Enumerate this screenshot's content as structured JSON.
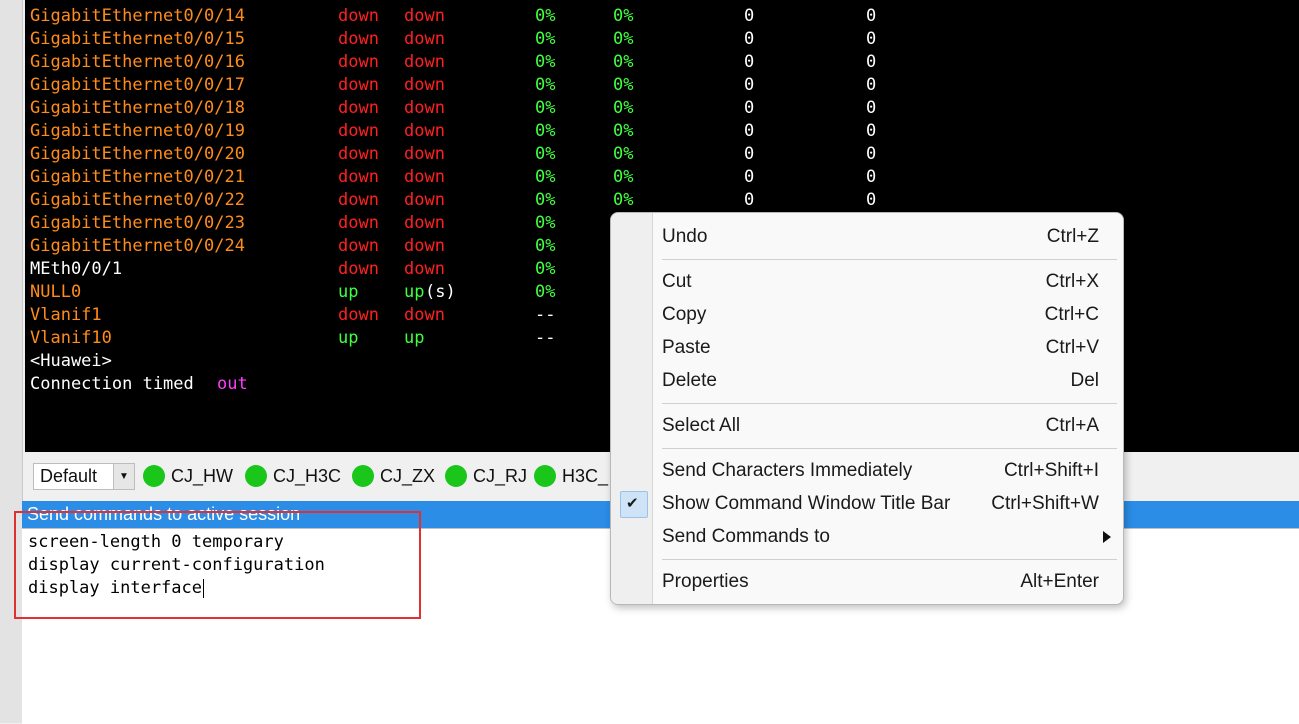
{
  "terminal": {
    "rows": [
      {
        "name": "GigabitEthernet0/0/14",
        "phy": "down",
        "proto": "down",
        "in_uti": "0%",
        "out_uti": "0%",
        "in_err": "0",
        "out_err": "0"
      },
      {
        "name": "GigabitEthernet0/0/15",
        "phy": "down",
        "proto": "down",
        "in_uti": "0%",
        "out_uti": "0%",
        "in_err": "0",
        "out_err": "0"
      },
      {
        "name": "GigabitEthernet0/0/16",
        "phy": "down",
        "proto": "down",
        "in_uti": "0%",
        "out_uti": "0%",
        "in_err": "0",
        "out_err": "0"
      },
      {
        "name": "GigabitEthernet0/0/17",
        "phy": "down",
        "proto": "down",
        "in_uti": "0%",
        "out_uti": "0%",
        "in_err": "0",
        "out_err": "0"
      },
      {
        "name": "GigabitEthernet0/0/18",
        "phy": "down",
        "proto": "down",
        "in_uti": "0%",
        "out_uti": "0%",
        "in_err": "0",
        "out_err": "0"
      },
      {
        "name": "GigabitEthernet0/0/19",
        "phy": "down",
        "proto": "down",
        "in_uti": "0%",
        "out_uti": "0%",
        "in_err": "0",
        "out_err": "0"
      },
      {
        "name": "GigabitEthernet0/0/20",
        "phy": "down",
        "proto": "down",
        "in_uti": "0%",
        "out_uti": "0%",
        "in_err": "0",
        "out_err": "0"
      },
      {
        "name": "GigabitEthernet0/0/21",
        "phy": "down",
        "proto": "down",
        "in_uti": "0%",
        "out_uti": "0%",
        "in_err": "0",
        "out_err": "0"
      },
      {
        "name": "GigabitEthernet0/0/22",
        "phy": "down",
        "proto": "down",
        "in_uti": "0%",
        "out_uti": "0%",
        "in_err": "0",
        "out_err": "0"
      },
      {
        "name": "GigabitEthernet0/0/23",
        "phy": "down",
        "proto": "down",
        "in_uti": "0%",
        "out_uti": "",
        "in_err": "",
        "out_err": ""
      },
      {
        "name": "GigabitEthernet0/0/24",
        "phy": "down",
        "proto": "down",
        "in_uti": "0%",
        "out_uti": "",
        "in_err": "",
        "out_err": ""
      },
      {
        "name": "MEth0/0/1",
        "phy": "down",
        "proto": "down",
        "in_uti": "0%",
        "out_uti": "",
        "in_err": "",
        "out_err": ""
      },
      {
        "name": "NULL0",
        "phy": "up",
        "proto": "up",
        "proto_suffix": "(s)",
        "in_uti": "0%",
        "out_uti": "",
        "in_err": "",
        "out_err": ""
      },
      {
        "name": "Vlanif1",
        "phy": "down",
        "proto": "down",
        "in_uti": "--",
        "out_uti": "",
        "in_err": "",
        "out_err": ""
      },
      {
        "name": "Vlanif10",
        "phy": "up",
        "proto": "up",
        "in_uti": "--",
        "out_uti": "",
        "in_err": "",
        "out_err": ""
      }
    ],
    "prompt": "<Huawei>",
    "timeout_prefix": "Connection timed ",
    "timeout_suffix": "out"
  },
  "session_bar": {
    "default_label": "Default",
    "sessions": [
      "CJ_HW",
      "CJ_H3C",
      "CJ_ZX",
      "CJ_RJ",
      "H3C_"
    ]
  },
  "command_window": {
    "title": "Send commands to active session",
    "lines": [
      "screen-length 0 temporary",
      "display current-configuration",
      "display interface"
    ]
  },
  "context_menu": {
    "items": [
      {
        "label": "Undo",
        "shortcut": "Ctrl+Z"
      },
      {
        "label": "Cut",
        "shortcut": "Ctrl+X"
      },
      {
        "label": "Copy",
        "shortcut": "Ctrl+C"
      },
      {
        "label": "Paste",
        "shortcut": "Ctrl+V"
      },
      {
        "label": "Delete",
        "shortcut": "Del"
      },
      {
        "label": "Select All",
        "shortcut": "Ctrl+A"
      },
      {
        "label": "Send Characters Immediately",
        "shortcut": "Ctrl+Shift+I"
      },
      {
        "label": "Show Command Window Title Bar",
        "shortcut": "Ctrl+Shift+W",
        "checked": true
      },
      {
        "label": "Send Commands to",
        "shortcut": "",
        "submenu": true
      },
      {
        "label": "Properties",
        "shortcut": "Alt+Enter"
      }
    ]
  },
  "colors": {
    "interface_name": "#ff8c1a",
    "status_down": "#ff2020",
    "status_up": "#40ff40",
    "title_bar": "#2b8de6",
    "session_dot": "#19c619"
  },
  "icons": {
    "session_status": "green-circle-icon",
    "checkmark": "checkmark-icon",
    "submenu": "chevron-right-icon",
    "dropdown": "chevron-down-icon"
  }
}
